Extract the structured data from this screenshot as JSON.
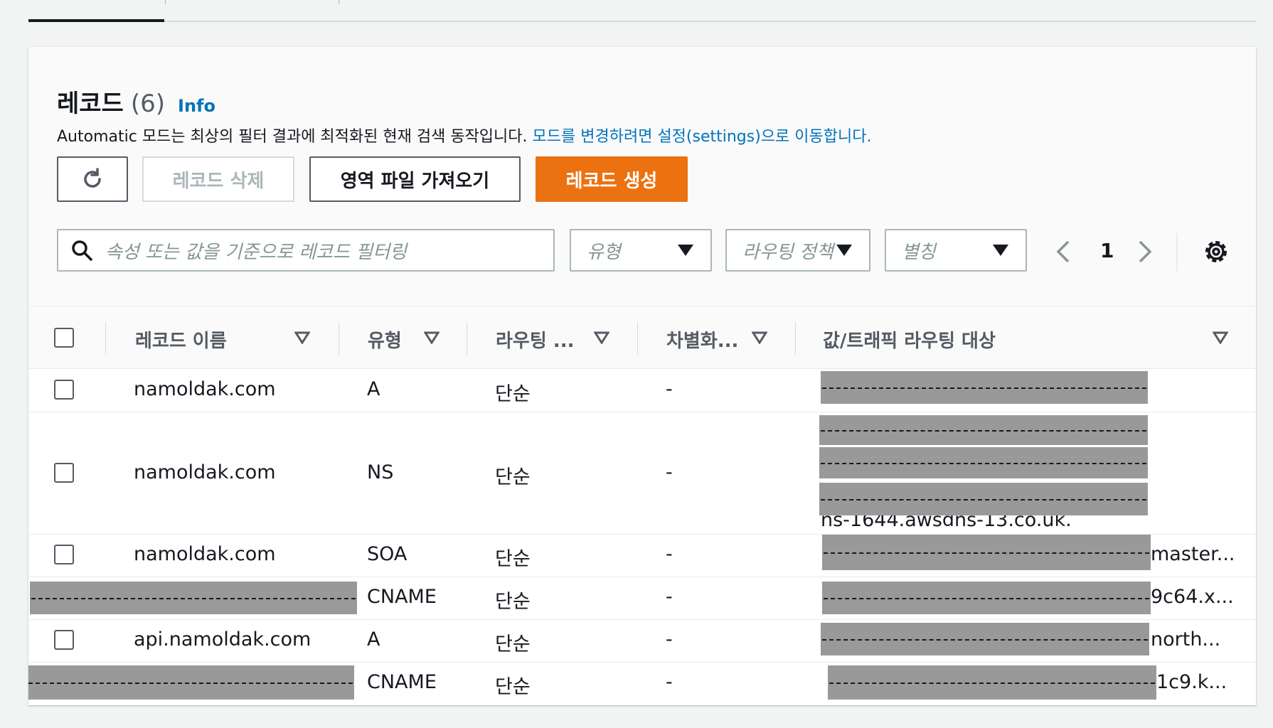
{
  "header": {
    "title": "레코드",
    "count": "(6)",
    "info_link": "Info",
    "description": "Automatic 모드는 최상의 필터 결과에 최적화된 현재 검색 동작입니다.",
    "description_link": "모드를 변경하려면 설정(settings)으로 이동합니다."
  },
  "toolbar": {
    "refresh_icon": "refresh-icon",
    "delete_label": "레코드 삭제",
    "import_label": "영역 파일 가져오기",
    "create_label": "레코드 생성"
  },
  "filters": {
    "search_placeholder": "속성 또는 값을 기준으로 레코드 필터링",
    "type_placeholder": "유형",
    "routing_placeholder": "라우팅 정책",
    "alias_placeholder": "별칭"
  },
  "pagination": {
    "current_page": "1"
  },
  "table": {
    "columns": [
      "레코드 이름",
      "유형",
      "라우팅 ...",
      "차별화...",
      "값/트래픽 라우팅 대상"
    ],
    "rows": [
      {
        "name": "namoldak.com",
        "type": "A",
        "routing": "단순",
        "diff": "-",
        "value_suffix": ""
      },
      {
        "name": "namoldak.com",
        "type": "NS",
        "routing": "단순",
        "diff": "-",
        "value_suffix": "ns-1644.awsdns-13.co.uk."
      },
      {
        "name": "namoldak.com",
        "type": "SOA",
        "routing": "단순",
        "diff": "-",
        "value_suffix": "master..."
      },
      {
        "name": "",
        "type": "CNAME",
        "routing": "단순",
        "diff": "-",
        "value_suffix": "9c64.x..."
      },
      {
        "name": "api.namoldak.com",
        "type": "A",
        "routing": "단순",
        "diff": "-",
        "value_suffix": "north..."
      },
      {
        "name": "",
        "type": "CNAME",
        "routing": "단순",
        "diff": "-",
        "value_suffix": "1c9.k..."
      }
    ]
  },
  "colors": {
    "accent": "#ec7211",
    "link": "#0073bb",
    "redaction": "#999999"
  }
}
